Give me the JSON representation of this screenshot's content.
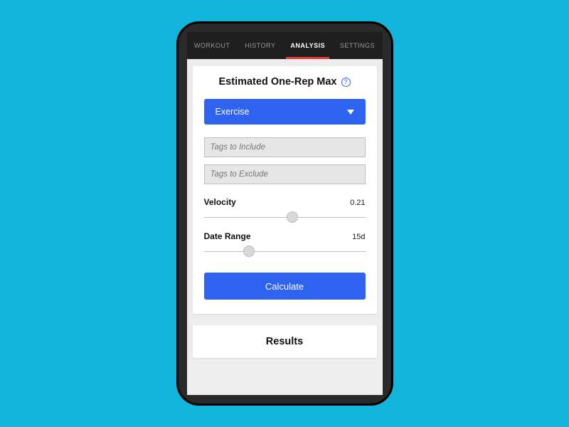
{
  "tabs": {
    "items": [
      {
        "label": "WORKOUT",
        "active": false
      },
      {
        "label": "HISTORY",
        "active": false
      },
      {
        "label": "ANALYSIS",
        "active": true
      },
      {
        "label": "SETTINGS",
        "active": false
      }
    ]
  },
  "card": {
    "title": "Estimated One-Rep Max",
    "help": "?",
    "exercise_label": "Exercise",
    "tags_include_placeholder": "Tags to Include",
    "tags_exclude_placeholder": "Tags to Exclude",
    "velocity": {
      "label": "Velocity",
      "value": "0.21",
      "pos_pct": 55
    },
    "daterange": {
      "label": "Date Range",
      "value": "15d",
      "pos_pct": 28
    },
    "calculate_label": "Calculate"
  },
  "results": {
    "title": "Results"
  },
  "colors": {
    "background": "#12b5db",
    "primary": "#2e63f0",
    "tab_active_underline": "#e33a2f"
  }
}
